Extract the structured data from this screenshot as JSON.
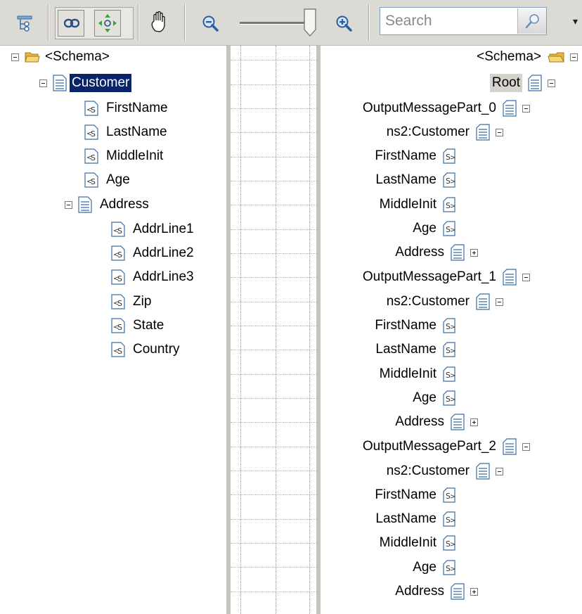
{
  "toolbar": {
    "search_placeholder": "Search"
  },
  "source_tree": {
    "root": "<Schema>",
    "customer": "Customer",
    "fields": [
      "FirstName",
      "LastName",
      "MiddleInit",
      "Age"
    ],
    "address": "Address",
    "address_fields": [
      "AddrLine1",
      "AddrLine2",
      "AddrLine3",
      "Zip",
      "State",
      "Country"
    ]
  },
  "dest_tree": {
    "root": "<Schema>",
    "root_node": "Root",
    "customer_label": "ns2:Customer",
    "fields": [
      "FirstName",
      "LastName",
      "MiddleInit",
      "Age"
    ],
    "address": "Address",
    "parts": [
      "OutputMessagePart_0",
      "OutputMessagePart_1",
      "OutputMessagePart_2"
    ]
  },
  "colors": {
    "selection": "#0a246a",
    "toolbar_bg": "#dcdad5",
    "folder": "#f2c24a",
    "record_icon": "#3a6ea5",
    "field_icon": "#3a6ea5",
    "grid_border": "#c6c3bc"
  },
  "icons": {
    "toolbar": [
      "tree-view-icon",
      "link-icon",
      "fit-view-icon",
      "pan-hand-icon",
      "zoom-out-icon",
      "zoom-in-icon",
      "search-icon",
      "more-options-icon"
    ],
    "nodes": [
      "folder-icon",
      "record-icon",
      "field-element-icon",
      "collapse-icon",
      "expand-icon"
    ]
  }
}
